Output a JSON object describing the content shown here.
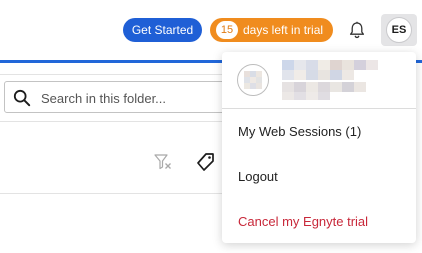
{
  "header": {
    "get_started_label": "Get Started",
    "trial_days": "15",
    "trial_label": "days left in trial",
    "avatar_initials": "ES"
  },
  "colors": {
    "primary": "#1f5fd6",
    "trial": "#f08c1e",
    "danger": "#c8283a"
  },
  "icons": {
    "notifications": "bell-icon",
    "search": "search-icon",
    "filter": "clear-filter-icon",
    "tag": "tag-icon"
  },
  "search": {
    "placeholder": "Search in this folder..."
  },
  "user_menu": {
    "items": [
      {
        "label": "My Web Sessions (1)"
      },
      {
        "label": "Logout"
      },
      {
        "label": "Cancel my Egnyte trial"
      }
    ]
  }
}
